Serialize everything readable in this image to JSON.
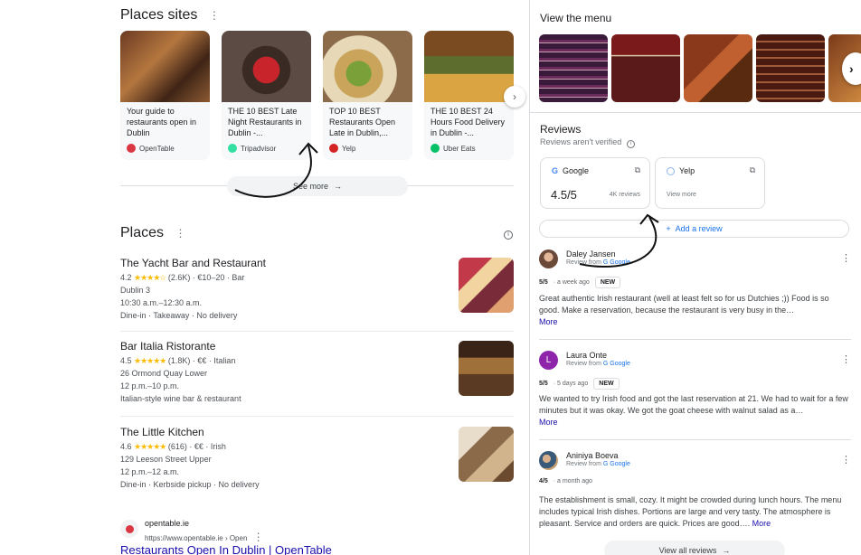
{
  "places_sites": {
    "title": "Places sites",
    "kebab": "⋮",
    "cards": [
      {
        "text": "Your guide to restaurants open in Dublin",
        "source": "OpenTable",
        "source_color": "#da3743"
      },
      {
        "text": "THE 10 BEST Late Night Restaurants in Dublin -...",
        "source": "Tripadvisor",
        "source_color": "#34e0a1"
      },
      {
        "text": "TOP 10 BEST Restaurants Open Late in Dublin,...",
        "source": "Yelp",
        "source_color": "#d32323"
      },
      {
        "text": "THE 10 BEST 24 Hours Food Delivery in Dublin -...",
        "source": "Uber Eats",
        "source_color": "#06c167"
      }
    ],
    "next_icon": "›",
    "see_more": "See more",
    "see_more_arrow": "→"
  },
  "places": {
    "title": "Places",
    "kebab": "⋮",
    "info_icon": "i",
    "items": [
      {
        "name": "The Yacht Bar and Restaurant",
        "rating": "4.2",
        "stars": "★★★★☆",
        "details": "(2.6K) · €10–20 · Bar",
        "address": "Dublin 3",
        "hours": "10:30 a.m.–12:30 a.m.",
        "extra": "Dine-in · Takeaway · No delivery"
      },
      {
        "name": "Bar Italia Ristorante",
        "rating": "4.5",
        "stars": "★★★★★",
        "details": "(1.8K) · €€ · Italian",
        "address": "26 Ormond Quay Lower",
        "hours": "12 p.m.–10 p.m.",
        "extra": "Italian-style wine bar & restaurant"
      },
      {
        "name": "The Little Kitchen",
        "rating": "4.6",
        "stars": "★★★★★",
        "details": "(616) · €€ · Irish",
        "address": "129 Leeson Street Upper",
        "hours": "12 p.m.–12 a.m.",
        "extra": "Dine-in · Kerbside pickup · No delivery"
      }
    ]
  },
  "opentable_result": {
    "name": "opentable.ie",
    "url": "https://www.opentable.ie › Open",
    "title": "Restaurants Open In Dublin | OpenTable"
  },
  "menu": {
    "title": "View the menu",
    "next_icon": "›"
  },
  "reviews": {
    "title": "Reviews",
    "subtitle": "Reviews aren't verified",
    "info_icon": "i",
    "sources": [
      {
        "name": "Google",
        "rating": "4.5/5",
        "count": "4K reviews",
        "ext_icon": "⧉"
      },
      {
        "name": "Yelp",
        "view": "View more",
        "ext_icon": "⧉"
      }
    ],
    "add_review": "Add a review",
    "add_icon": "+",
    "items": [
      {
        "name": "Daley Jansen",
        "from": "Review from",
        "source": "Google",
        "score": "5/5",
        "time": "· a week ago",
        "badge": "NEW",
        "text": "Great authentic Irish restaurant (well at least felt so for us Dutchies ;)) Food is so good. Make a reservation, because the restaurant is very busy in the…",
        "more": "More",
        "menu": "⋮"
      },
      {
        "name": "Laura Onte",
        "from": "Review from",
        "source": "Google",
        "score": "5/5",
        "time": "· 5 days ago",
        "badge": "NEW",
        "text": "We wanted to try Irish food and got the last reservation at 21. We had to wait for a few minutes but it was okay. We got the goat cheese with walnut salad as a…",
        "more": "More",
        "menu": "⋮",
        "initial": "L"
      },
      {
        "name": "Aniniya Boeva",
        "from": "Review from",
        "source": "Google",
        "score": "4/5",
        "time": "· a month ago",
        "text": "The establishment is small, cozy. It might be crowded during lunch hours. The menu includes typical Irish dishes. Portions are large and very tasty. The atmosphere is pleasant. Service and orders are quick. Prices are good….",
        "more": "More",
        "menu": "⋮"
      }
    ],
    "view_all": "View all reviews",
    "view_all_arrow": "→"
  }
}
